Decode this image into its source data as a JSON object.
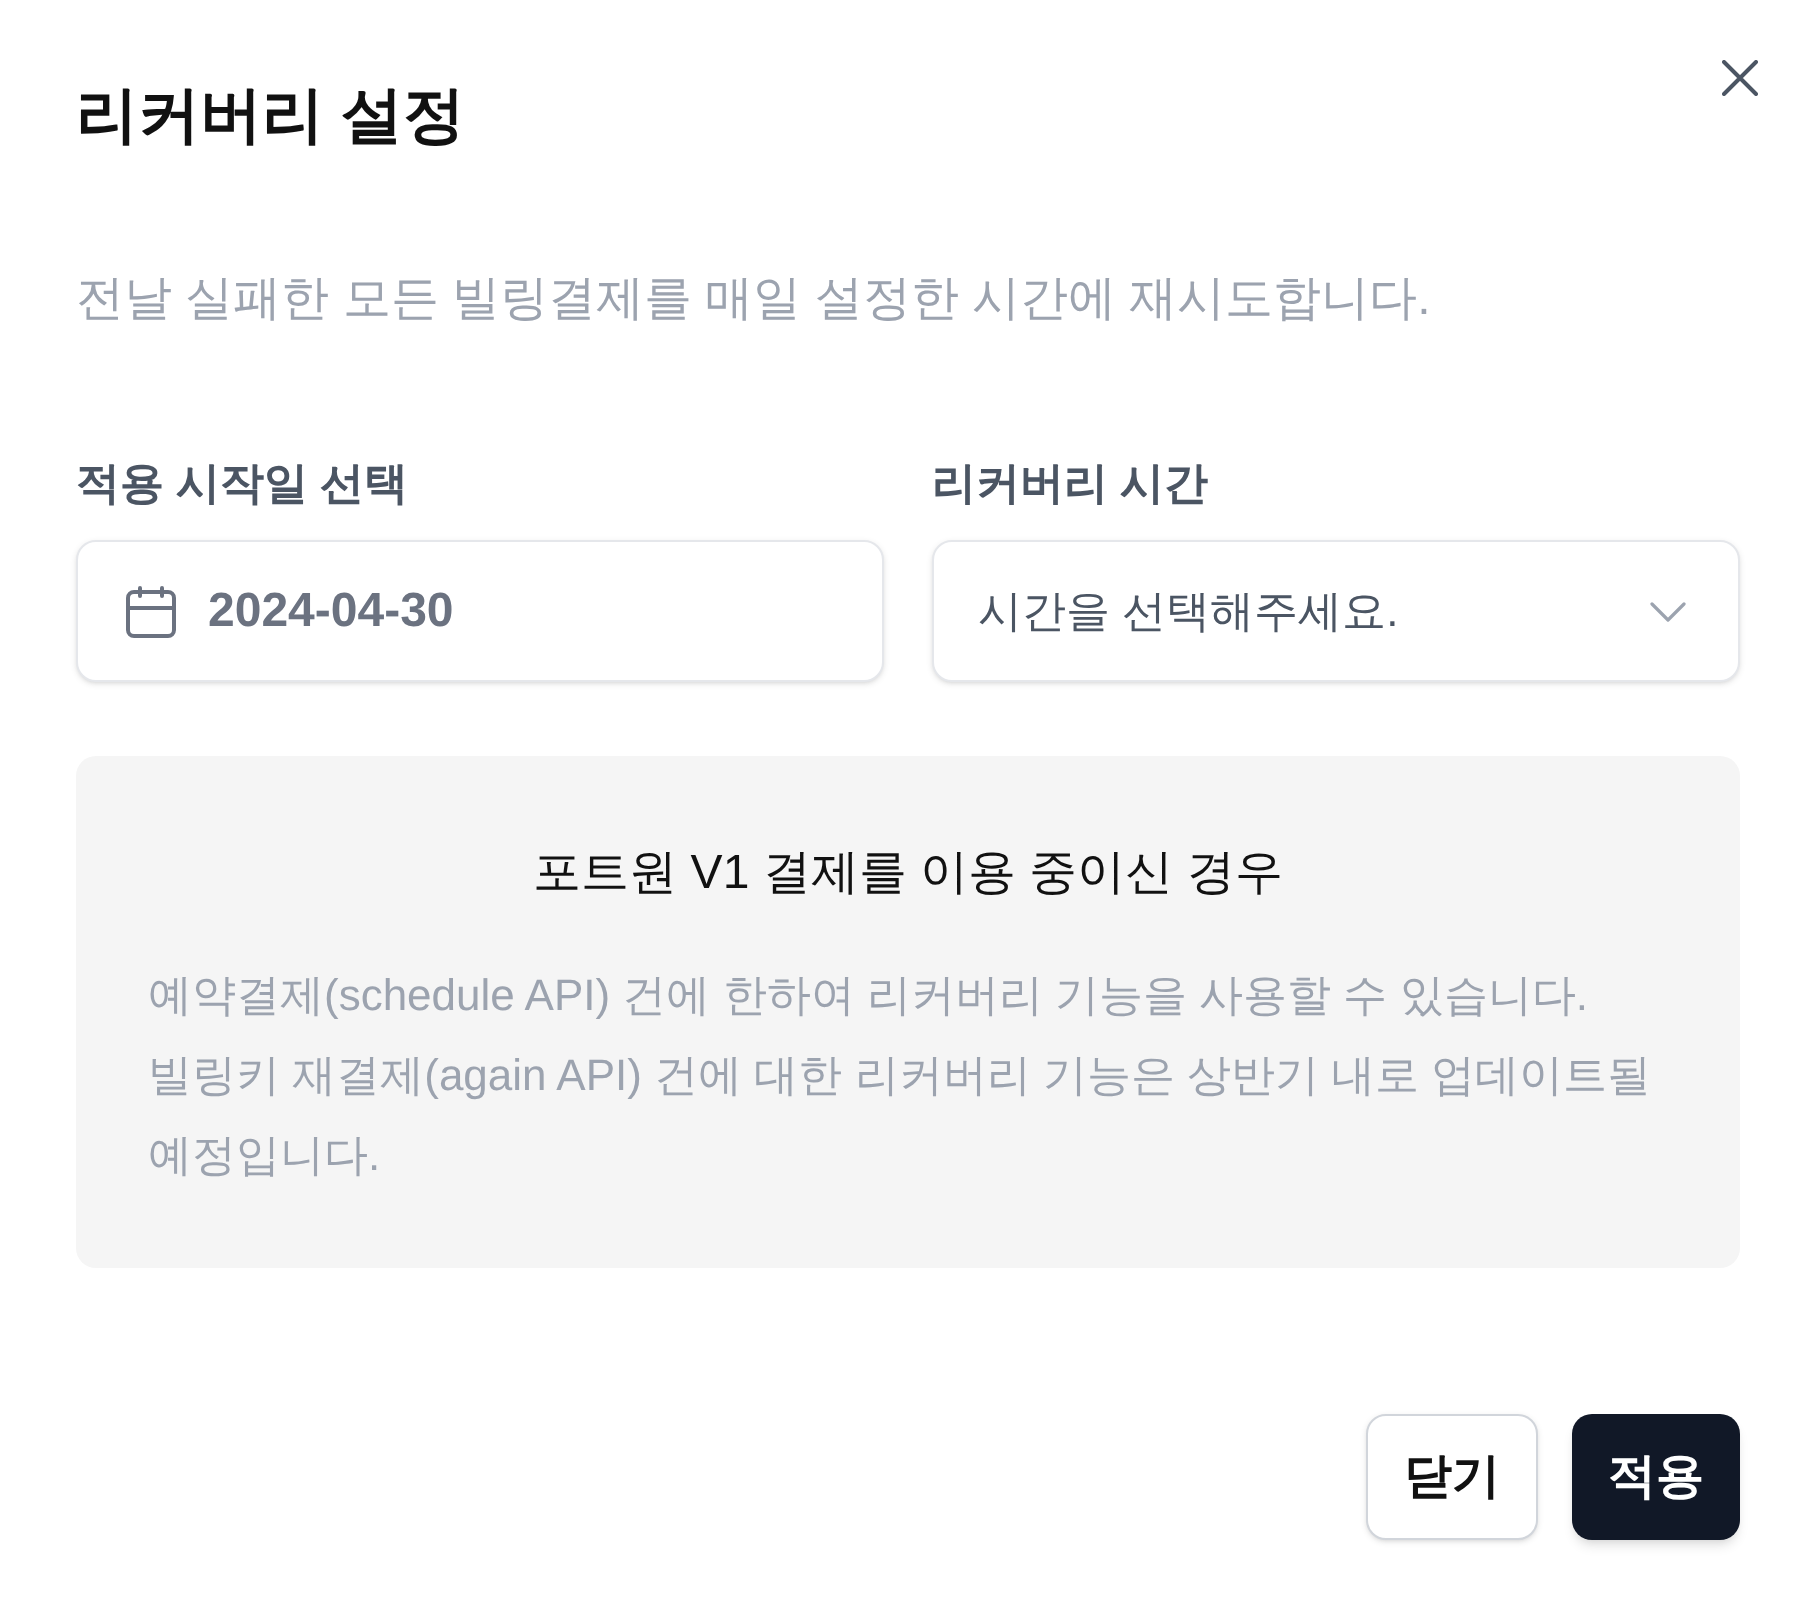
{
  "dialog": {
    "title": "리커버리 설정",
    "description": "전날 실패한 모든 빌링결제를 매일 설정한 시간에 재시도합니다."
  },
  "fields": [
    {
      "kind": "date",
      "label": "적용 시작일 선택",
      "value": "2024-04-30"
    },
    {
      "kind": "select",
      "label": "리커버리 시간",
      "placeholder": "시간을 선택해주세요."
    }
  ],
  "notice": {
    "title": "포트원 V1 결제를 이용 중이신 경우",
    "paragraphs": [
      "예약결제(schedule API) 건에 한하여 리커버리 기능을 사용할 수 있습니다.",
      "빌링키 재결제(again API) 건에 대한 리커버리 기능은 상반기 내로 업데이트될 예정입니다."
    ]
  },
  "buttons": [
    {
      "kind": "secondary",
      "label": "닫기"
    },
    {
      "kind": "primary",
      "label": "적용"
    }
  ]
}
